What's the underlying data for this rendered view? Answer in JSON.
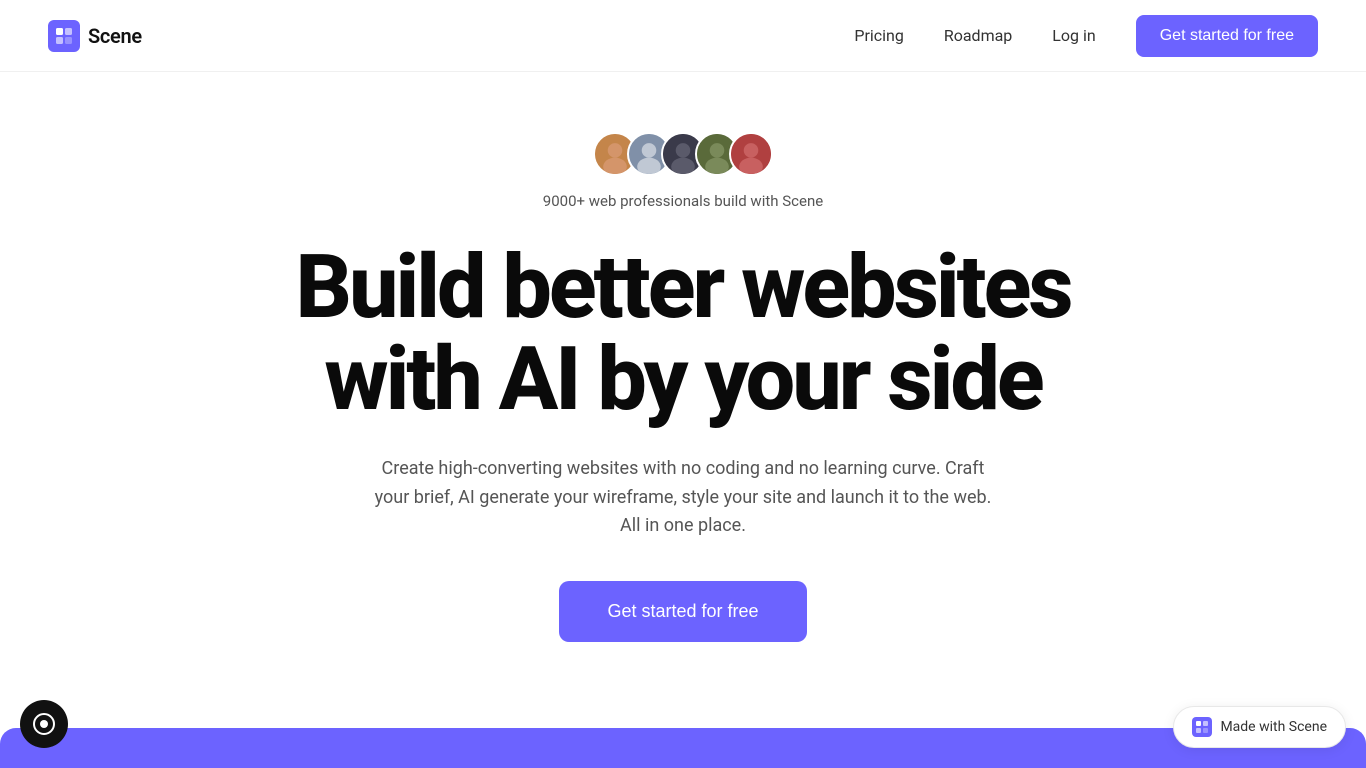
{
  "nav": {
    "logo_text": "Scene",
    "links": [
      {
        "label": "Pricing",
        "id": "pricing"
      },
      {
        "label": "Roadmap",
        "id": "roadmap"
      },
      {
        "label": "Log in",
        "id": "login"
      }
    ],
    "cta_label": "Get started for free"
  },
  "hero": {
    "social_proof": "9000+ web professionals build with Scene",
    "headline_line1": "Build better websites",
    "headline_line2": "with AI by your side",
    "subheadline": "Create high-converting websites with no coding and no learning curve. Craft your brief, AI generate your wireframe, style your site and launch it to the web. All in one place.",
    "cta_label": "Get started for free"
  },
  "footer": {
    "made_with": "Made with Scene"
  },
  "colors": {
    "accent": "#6c63ff",
    "text_primary": "#0a0a0a",
    "text_secondary": "#555555"
  },
  "avatars": [
    {
      "emoji": "👩",
      "bg": "#d4a574"
    },
    {
      "emoji": "👱",
      "bg": "#a0b4c8"
    },
    {
      "emoji": "🧑",
      "bg": "#4a4a5a"
    },
    {
      "emoji": "👦",
      "bg": "#6a7a4a"
    },
    {
      "emoji": "😊",
      "bg": "#c44a4a"
    }
  ]
}
